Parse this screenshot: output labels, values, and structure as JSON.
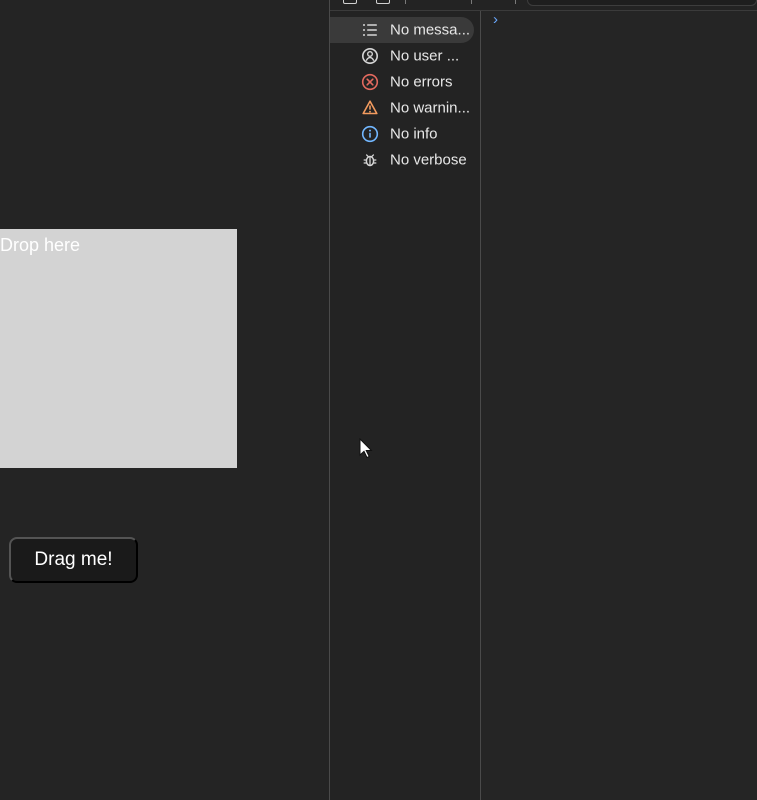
{
  "page": {
    "drop_zone_label": "Drop here",
    "drag_button_label": "Drag me!"
  },
  "devtools": {
    "items": [
      {
        "label": "No messa...",
        "icon": "list-icon"
      },
      {
        "label": "No user ...",
        "icon": "user-icon"
      },
      {
        "label": "No errors",
        "icon": "error-icon"
      },
      {
        "label": "No warnin...",
        "icon": "warning-icon"
      },
      {
        "label": "No info",
        "icon": "info-icon"
      },
      {
        "label": "No verbose",
        "icon": "bug-icon"
      }
    ],
    "prompt_symbol": "›"
  },
  "colors": {
    "background": "#242424",
    "drop_zone": "#d3d3d3",
    "selected_item": "#3a3a3a",
    "error": "#e46a5f",
    "warning": "#f29b5f",
    "info": "#72b7ff",
    "prompt": "#6aa9ff"
  }
}
